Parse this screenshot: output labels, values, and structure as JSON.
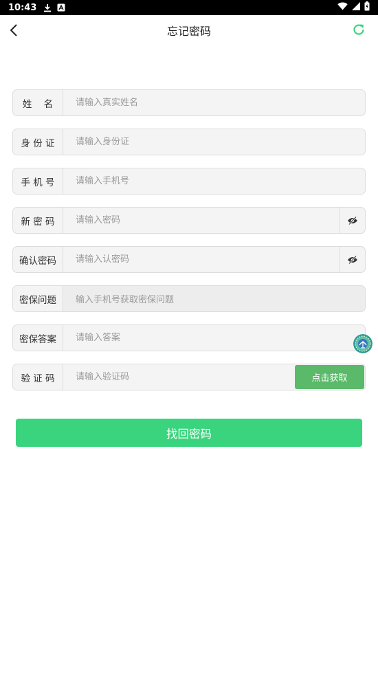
{
  "status_bar": {
    "time": "10:43"
  },
  "nav": {
    "title": "忘记密码"
  },
  "form": {
    "name": {
      "label": "姓    名",
      "placeholder": "请输入真实姓名"
    },
    "id_card": {
      "label": "身 份 证",
      "placeholder": "请输入身份证"
    },
    "phone": {
      "label": "手 机 号",
      "placeholder": "请输入手机号"
    },
    "new_pwd": {
      "label": "新 密 码",
      "placeholder": "请输入密码"
    },
    "confirm": {
      "label": "确认密码",
      "placeholder": "请输入认密码"
    },
    "question": {
      "label": "密保问题",
      "value": "输入手机号获取密保问题"
    },
    "answer": {
      "label": "密保答案",
      "placeholder": "请输入答案"
    },
    "code": {
      "label": "验 证 码",
      "placeholder": "请输入验证码",
      "button": "点击获取"
    }
  },
  "submit": {
    "label": "找回密码"
  },
  "colors": {
    "primary": "#3bd47e",
    "code_button": "#5bb96a",
    "refresh": "#3bd47e"
  },
  "icons": [
    "back-arrow-icon",
    "refresh-icon",
    "eye-hidden-icon",
    "download-icon",
    "signal-icon",
    "wifi-icon",
    "battery-icon",
    "floating-logo-icon"
  ]
}
